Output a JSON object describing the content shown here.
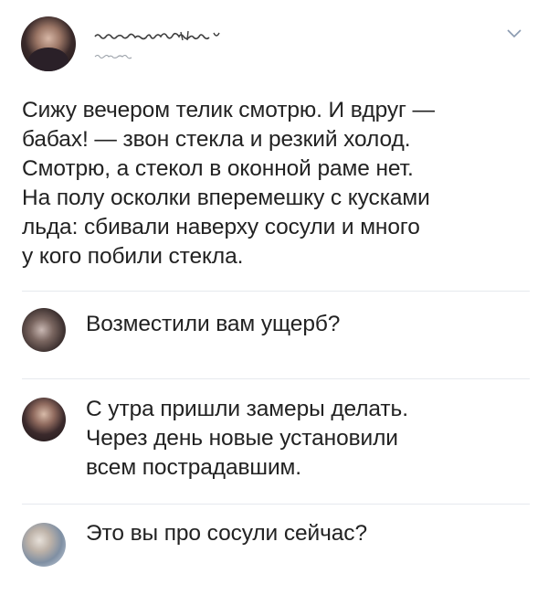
{
  "post": {
    "author_name_obscured": "",
    "text": "Сижу вечером телик смотрю. И вдруг —\nбабах! — звон стекла и резкий холод.\nСмотрю, а стекол в оконной раме нет.\nНа полу осколки вперемешку с кусками\nльда: сбивали наверху сосули и много\nу кого побили стекла."
  },
  "icons": {
    "menu": "chevron-down-icon"
  },
  "comments": [
    {
      "text": "Возместили вам ущерб?"
    },
    {
      "text": "С утра пришли замеры делать.\nЧерез день новые установили\nвсем пострадавшим."
    },
    {
      "text": "Это вы про сосули сейчас?"
    }
  ],
  "colors": {
    "text": "#222222",
    "divider": "#e6e9ee",
    "chevron": "#8a9ab0"
  }
}
